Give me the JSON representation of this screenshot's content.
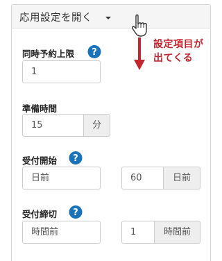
{
  "header": {
    "toggle_label": "応用設定を開く"
  },
  "annotation": {
    "line1": "設定項目が",
    "line2": "出てくる"
  },
  "fields": {
    "concurrent_limit": {
      "label": "同時予約上限",
      "value": "1"
    },
    "prep_time": {
      "label": "準備時間",
      "value": "15",
      "unit": "分"
    },
    "accept_start": {
      "label": "受付開始",
      "value": "日前",
      "number": "60",
      "unit": "日前"
    },
    "accept_deadline": {
      "label": "受付締切",
      "value": "時間前",
      "number": "1",
      "unit": "時間前"
    }
  },
  "colors": {
    "help_icon": "#1a73b8",
    "annotation": "#c3262f"
  }
}
